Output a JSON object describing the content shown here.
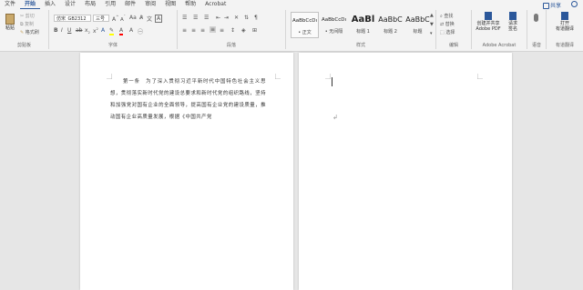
{
  "tabs": [
    "文件",
    "开始",
    "插入",
    "设计",
    "布局",
    "引用",
    "邮件",
    "审阅",
    "视图",
    "帮助",
    "Acrobat"
  ],
  "active_tab": "开始",
  "share_label": "共享",
  "clipboard": {
    "paste": "粘贴",
    "cut": "剪切",
    "copy": "复制",
    "format_painter": "格式刷",
    "label": "剪贴板"
  },
  "font": {
    "name": "仿宋_GB2312",
    "size": "三号",
    "label": "字体"
  },
  "paragraph": {
    "label": "段落"
  },
  "styles": {
    "items": [
      {
        "preview": "AaBbCcDı",
        "name": "• 正文"
      },
      {
        "preview": "AaBbCcDı",
        "name": "• 无间隔"
      },
      {
        "preview": "AaBl",
        "name": "标题 1"
      },
      {
        "preview": "AaBbC",
        "name": "标题 2"
      },
      {
        "preview": "AaBbC",
        "name": "标题"
      }
    ],
    "label": "样式"
  },
  "editing": {
    "find": "查找",
    "replace": "替换",
    "select": "选择",
    "label": "编辑"
  },
  "acrobat": {
    "create_share": "创建并共享",
    "create_share_2": "Adobe PDF",
    "request_sign": "请求",
    "request_sign_2": "签名",
    "label": "Adobe Acrobat"
  },
  "dictation": {
    "label": "语音"
  },
  "translate": {
    "open": "打开",
    "open_2": "有道翻译",
    "label": "有道翻译"
  },
  "document": {
    "paragraph": "第一条　为了深入贯彻习近平新时代中国特色社会主义思想，贯彻落实新时代党的建设总要求和新时代党的组织路线，坚持和加强党对国有企业的全面领导，提高国有企业党的建设质量，推动国有企业高质量发展，根据《中国共产党"
  },
  "colors": {
    "accent": "#2b579a",
    "highlight": "#ffff00",
    "font_color": "#ff0000"
  }
}
